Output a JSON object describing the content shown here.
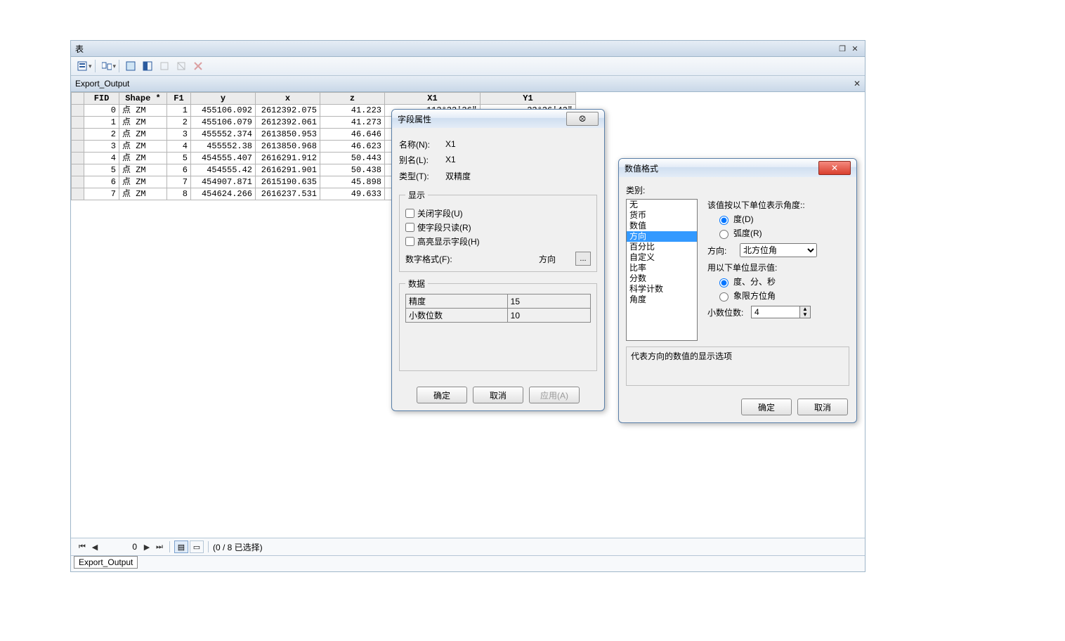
{
  "window": {
    "title": "表",
    "tab_name": "Export_Output",
    "bottom_tab": "Export_Output"
  },
  "toolbar_icons": [
    "table-options",
    "related-tables",
    "select-by-attributes",
    "switch-selection",
    "clear-selection",
    "delete-selected",
    "x-close"
  ],
  "grid": {
    "columns": [
      "FID",
      "Shape *",
      "F1",
      "y",
      "x",
      "z",
      "X1",
      "Y1"
    ],
    "selected_col": "X1",
    "rows": [
      {
        "FID": "0",
        "Shape": "点 ZM",
        "F1": "1",
        "y": "455106.092",
        "x": "2612392.075",
        "z": "41.223",
        "X1": "113°33′36″",
        "Y1": "23°36′43″"
      },
      {
        "FID": "1",
        "Shape": "点 ZM",
        "F1": "2",
        "y": "455106.079",
        "x": "2612392.061",
        "z": "41.273",
        "X1": "",
        "Y1": ""
      },
      {
        "FID": "2",
        "Shape": "点 ZM",
        "F1": "3",
        "y": "455552.374",
        "x": "2613850.953",
        "z": "46.646",
        "X1": "",
        "Y1": ""
      },
      {
        "FID": "3",
        "Shape": "点 ZM",
        "F1": "4",
        "y": "455552.38",
        "x": "2613850.968",
        "z": "46.623",
        "X1": "",
        "Y1": ""
      },
      {
        "FID": "4",
        "Shape": "点 ZM",
        "F1": "5",
        "y": "454555.407",
        "x": "2616291.912",
        "z": "50.443",
        "X1": "",
        "Y1": ""
      },
      {
        "FID": "5",
        "Shape": "点 ZM",
        "F1": "6",
        "y": "454555.42",
        "x": "2616291.901",
        "z": "50.438",
        "X1": "",
        "Y1": ""
      },
      {
        "FID": "6",
        "Shape": "点 ZM",
        "F1": "7",
        "y": "454907.871",
        "x": "2615190.635",
        "z": "45.898",
        "X1": "",
        "Y1": ""
      },
      {
        "FID": "7",
        "Shape": "点 ZM",
        "F1": "8",
        "y": "454624.266",
        "x": "2616237.531",
        "z": "49.633",
        "X1": "",
        "Y1": ""
      }
    ]
  },
  "nav": {
    "current": "0",
    "status": "(0 / 8 已选择)"
  },
  "field_dialog": {
    "title": "字段属性",
    "name_label": "名称(N):",
    "name_value": "X1",
    "alias_label": "别名(L):",
    "alias_value": "X1",
    "type_label": "类型(T):",
    "type_value": "双精度",
    "display_group": "显示",
    "chk_turnoff": "关闭字段(U)",
    "chk_readonly": "使字段只读(R)",
    "chk_highlight": "高亮显示字段(H)",
    "numfmt_label": "数字格式(F):",
    "numfmt_value": "方向",
    "more": "...",
    "data_group": "数据",
    "precision_label": "精度",
    "precision_value": "15",
    "scale_label": "小数位数",
    "scale_value": "10",
    "ok": "确定",
    "cancel": "取消",
    "apply": "应用(A)"
  },
  "numfmt_dialog": {
    "title": "数值格式",
    "category_label": "类别:",
    "categories": [
      "无",
      "货币",
      "数值",
      "方向",
      "百分比",
      "自定义",
      "比率",
      "分数",
      "科学计数",
      "角度"
    ],
    "selected_category": "方向",
    "angle_unit_label": "该值按以下单位表示角度::",
    "angle_unit_deg": "度(D)",
    "angle_unit_rad": "弧度(R)",
    "direction_label": "方向:",
    "direction_value": "北方位角",
    "display_unit_label": "用以下单位显示值:",
    "display_dms": "度、分、秒",
    "display_quad": "象限方位角",
    "decimals_label": "小数位数:",
    "decimals_value": "4",
    "description": "代表方向的数值的显示选项",
    "ok": "确定",
    "cancel": "取消"
  }
}
